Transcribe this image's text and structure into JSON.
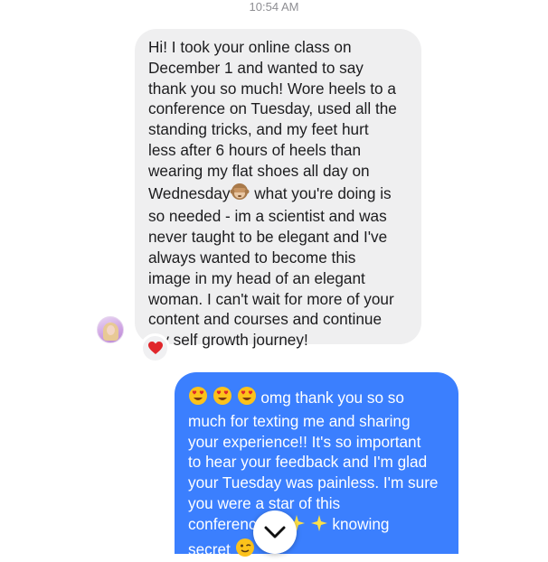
{
  "header": {
    "time": "10:54 AM"
  },
  "messages": {
    "received": {
      "text": "Hi! I took your online class on\nDecember 1 and wanted to say\nthank you so much! Wore heels to a\nconference on Tuesday, used all the\nstanding tricks, and my feet hurt\nless after 6 hours of heels than\nwearing my flat shoes all day on\nWednesday",
      "emoji": "see-no-evil-monkey-emoji",
      "text_after": " what you're doing is\nso needed - im a scientist and was\nnever taught to be elegant and I've\nalways wanted to become this\nimage in my head of an elegant\nwoman. I can't wait for more of your\ncontent and courses and continue\nmy self growth journey!",
      "reaction": "heart-emoji"
    },
    "sent": {
      "emojis_start": [
        "heart-eyes-emoji",
        "heart-eyes-emoji",
        "heart-eyes-emoji"
      ],
      "text": " omg thank you so so\nmuch for texting me and sharing\nyour experience!! It's so important\nto hear your feedback and I'm glad\nyour Tuesday was painless. I'm sure\nyou were a star of this\nconference",
      "sparkles": [
        "sparkles-emoji",
        "sparkles-emoji",
        "sparkles-emoji"
      ],
      "text_end": " knowing\nsecret",
      "emoji_end": "winking-emoji"
    }
  },
  "colors": {
    "received_bubble": "#efeff0",
    "sent_bubble": "#3b7ffe",
    "timestamp": "#8e8e93"
  },
  "icons": {
    "scroll_down": "chevron-down-icon",
    "avatar": "user-avatar"
  }
}
